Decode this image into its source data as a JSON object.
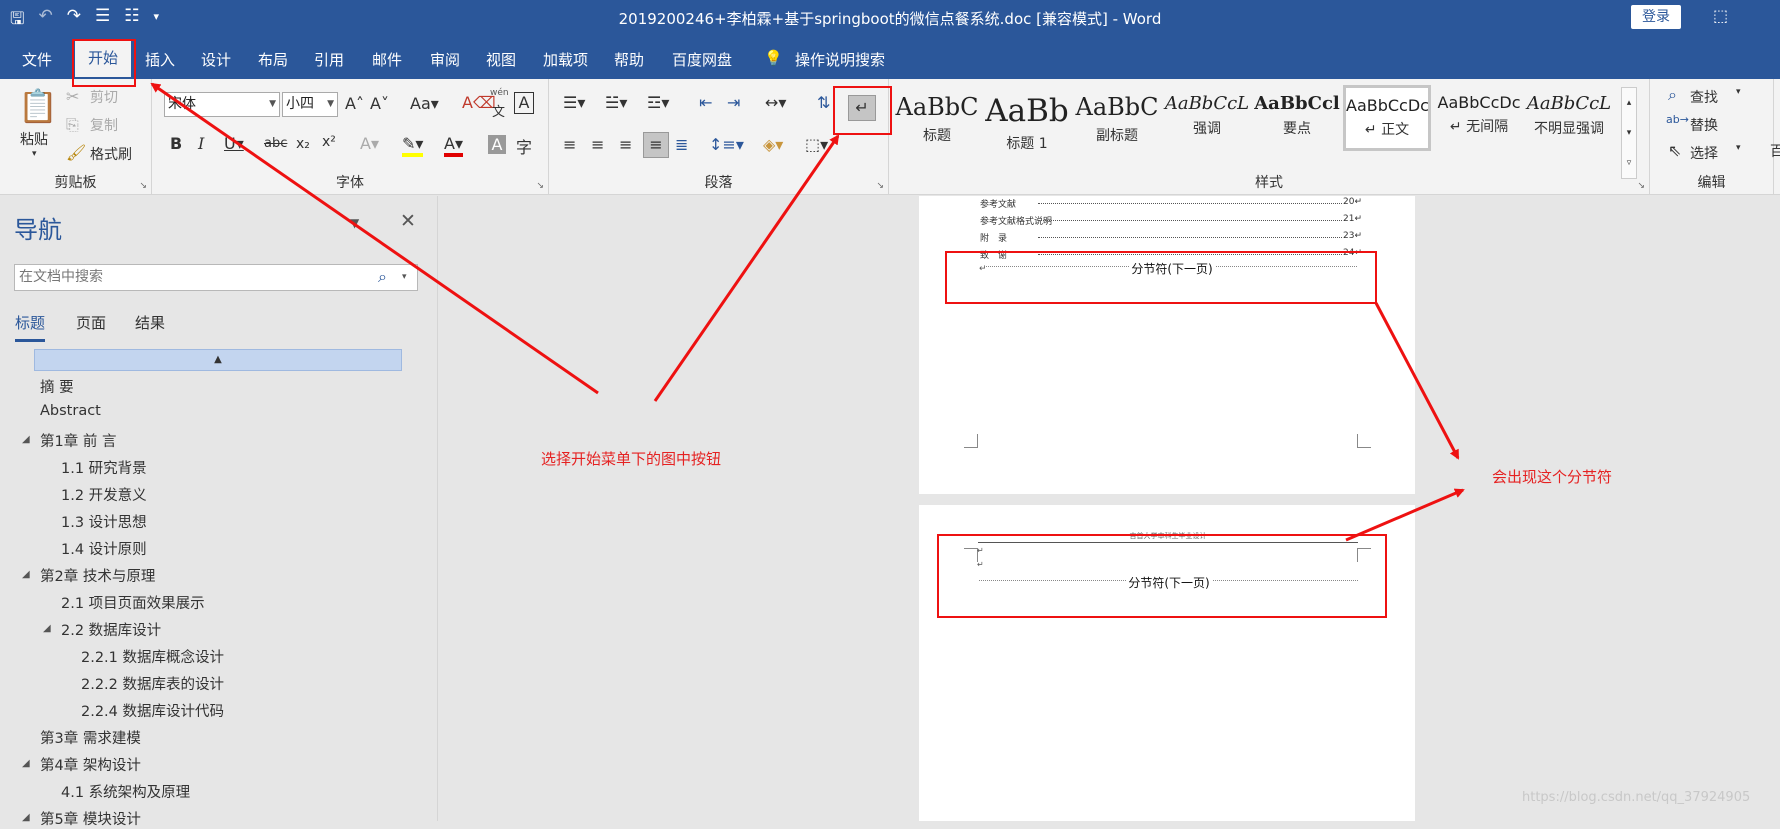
{
  "app": {
    "title": "2019200246+李柏霖+基于springboot的微信点餐系统.doc [兼容模式] - Word",
    "login": "登录"
  },
  "menu": {
    "file": "文件",
    "home": "开始",
    "insert": "插入",
    "design": "设计",
    "layout": "布局",
    "references": "引用",
    "mailings": "邮件",
    "review": "审阅",
    "view": "视图",
    "addins": "加载项",
    "help": "帮助",
    "baidu": "百度网盘",
    "tellme": "操作说明搜索"
  },
  "clipboard": {
    "paste": "粘贴",
    "cut": "剪切",
    "copy": "复制",
    "format_painter": "格式刷",
    "label": "剪贴板"
  },
  "font": {
    "name": "宋体",
    "size": "小四",
    "label": "字体",
    "phonetic_top": "wén",
    "phonetic_bottom": "文"
  },
  "paragraph": {
    "label": "段落"
  },
  "styles": {
    "label": "样式",
    "items": [
      {
        "preview": "AaBbC",
        "name": "标题"
      },
      {
        "preview": "AaBb",
        "name": "标题 1"
      },
      {
        "preview": "AaBbC",
        "name": "副标题"
      },
      {
        "preview": "AaBbCcL",
        "name": "强调"
      },
      {
        "preview": "AaBbCcl",
        "name": "要点"
      },
      {
        "preview": "AaBbCcDc",
        "name": "↵ 正文"
      },
      {
        "preview": "AaBbCcDc",
        "name": "↵ 无间隔"
      },
      {
        "preview": "AaBbCcL",
        "name": "不明显强调"
      }
    ]
  },
  "editing": {
    "find": "查找",
    "replace": "替换",
    "select": "选择",
    "label": "编辑",
    "overflow": "百"
  },
  "nav": {
    "title": "导航",
    "search_placeholder": "在文档中搜索",
    "tabs": [
      "标题",
      "页面",
      "结果"
    ]
  },
  "headings": [
    "摘 要",
    "Abstract",
    "第1章 前 言",
    "1.1 研究背景",
    "1.2 开发意义",
    "1.3 设计思想",
    "1.4 设计原则",
    "第2章 技术与原理",
    "2.1 项目页面效果展示",
    "2.2 数据库设计",
    "2.2.1 数据库概念设计",
    "2.2.2 数据库表的设计",
    "2.2.4 数据库设计代码",
    "第3章 需求建模",
    "第4章 架构设计",
    "4.1 系统架构及原理",
    "第5章 模块设计"
  ],
  "doc": {
    "toc_lines": [
      {
        "text": "参考文献",
        "page": "20↵"
      },
      {
        "text": "参考文献格式说明",
        "page": "21↵"
      },
      {
        "text": "附　录",
        "page": "23↵"
      },
      {
        "text": "致　谢",
        "page": "24↵"
      }
    ],
    "section_break": "分节符(下一页)",
    "page2_header": "吉首大学本科生毕业设计",
    "mark": "↵"
  },
  "annotations": {
    "step": "选择开始菜单下的图中按钮",
    "result": "会出现这个分节符"
  },
  "watermark": "https://blog.csdn.net/qq_37924905",
  "colors": {
    "accent": "#2b579a",
    "annotation": "#ee1111"
  }
}
